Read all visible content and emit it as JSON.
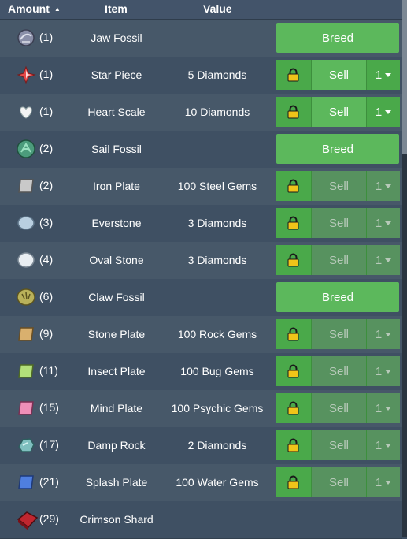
{
  "header": {
    "amount": "Amount",
    "item": "Item",
    "value": "Value"
  },
  "buttons": {
    "breed": "Breed",
    "sell": "Sell",
    "qty": "1"
  },
  "colors": {
    "accent": "#5cb85c",
    "row_alt": "#475869",
    "row_base": "#3f5063"
  },
  "rows": [
    {
      "icon": "jaw-fossil-icon",
      "amount": "(1)",
      "item": "Jaw Fossil",
      "value": "",
      "action": "breed"
    },
    {
      "icon": "star-piece-icon",
      "amount": "(1)",
      "item": "Star Piece",
      "value": "5 Diamonds",
      "action": "sell"
    },
    {
      "icon": "heart-scale-icon",
      "amount": "(1)",
      "item": "Heart Scale",
      "value": "10 Diamonds",
      "action": "sell"
    },
    {
      "icon": "sail-fossil-icon",
      "amount": "(2)",
      "item": "Sail Fossil",
      "value": "",
      "action": "breed"
    },
    {
      "icon": "iron-plate-icon",
      "amount": "(2)",
      "item": "Iron Plate",
      "value": "100 Steel Gems",
      "action": "sell-disabled"
    },
    {
      "icon": "everstone-icon",
      "amount": "(3)",
      "item": "Everstone",
      "value": "3 Diamonds",
      "action": "sell-disabled"
    },
    {
      "icon": "oval-stone-icon",
      "amount": "(4)",
      "item": "Oval Stone",
      "value": "3 Diamonds",
      "action": "sell-disabled"
    },
    {
      "icon": "claw-fossil-icon",
      "amount": "(6)",
      "item": "Claw Fossil",
      "value": "",
      "action": "breed"
    },
    {
      "icon": "stone-plate-icon",
      "amount": "(9)",
      "item": "Stone Plate",
      "value": "100 Rock Gems",
      "action": "sell-disabled"
    },
    {
      "icon": "insect-plate-icon",
      "amount": "(11)",
      "item": "Insect Plate",
      "value": "100 Bug Gems",
      "action": "sell-disabled"
    },
    {
      "icon": "mind-plate-icon",
      "amount": "(15)",
      "item": "Mind Plate",
      "value": "100 Psychic Gems",
      "action": "sell-disabled"
    },
    {
      "icon": "damp-rock-icon",
      "amount": "(17)",
      "item": "Damp Rock",
      "value": "2 Diamonds",
      "action": "sell-disabled"
    },
    {
      "icon": "splash-plate-icon",
      "amount": "(21)",
      "item": "Splash Plate",
      "value": "100 Water Gems",
      "action": "sell-disabled"
    },
    {
      "icon": "crimson-shard-icon",
      "amount": "(29)",
      "item": "Crimson Shard",
      "value": "",
      "action": "none"
    }
  ]
}
